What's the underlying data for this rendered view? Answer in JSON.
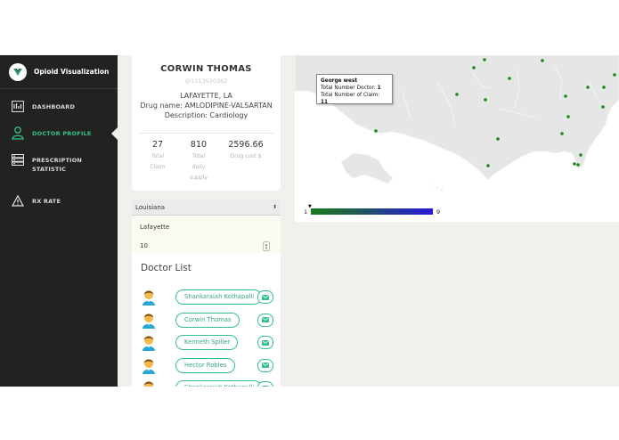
{
  "app": {
    "title": "Opioid Visualization"
  },
  "sidebar": {
    "items": [
      {
        "label": "DASHBOARD",
        "icon": "chart-icon",
        "active": false
      },
      {
        "label": "DOCTOR PROFILE",
        "icon": "person-icon",
        "active": true
      },
      {
        "label": "PRESCRIPTION STATISTIC",
        "icon": "server-icon",
        "active": false
      },
      {
        "label": "RX RATE",
        "icon": "warning-icon",
        "active": false
      }
    ]
  },
  "profile": {
    "name": "CORWIN THOMAS",
    "id": "@1013920362",
    "location": "LAFAYETTE, LA",
    "drug": "Drug name: AMLODIPINE-VALSARTAN",
    "description": "Description: Cardiology",
    "stats": [
      {
        "value": "27",
        "caption": "Total Claim"
      },
      {
        "value": "810",
        "caption": "Total daily supply"
      },
      {
        "value": "2596.66",
        "caption": "Drug cost $"
      }
    ]
  },
  "filters": {
    "state": "Louisiana",
    "city": "Lafayette",
    "count": "10"
  },
  "doctor_list": {
    "title": "Doctor List",
    "doctors": [
      "Shankaraiah Kothapalli",
      "Corwin Thomas",
      "Kenneth Spiller",
      "Hector Robles",
      "Shankaraiah Kothapalli"
    ]
  },
  "map": {
    "tooltip": {
      "title": "George west",
      "doctor_label": "Total Number Doctor: ",
      "doctor_value": "1",
      "claim_label": "Total Number of Claim: ",
      "claim_value": "11"
    },
    "legend": {
      "min": "1",
      "max": "9"
    }
  },
  "colors": {
    "sidebar_bg": "#222321",
    "accent_green": "#33c08a",
    "map_land": "#e6e6e6",
    "map_dot": "#1a8a1a"
  }
}
